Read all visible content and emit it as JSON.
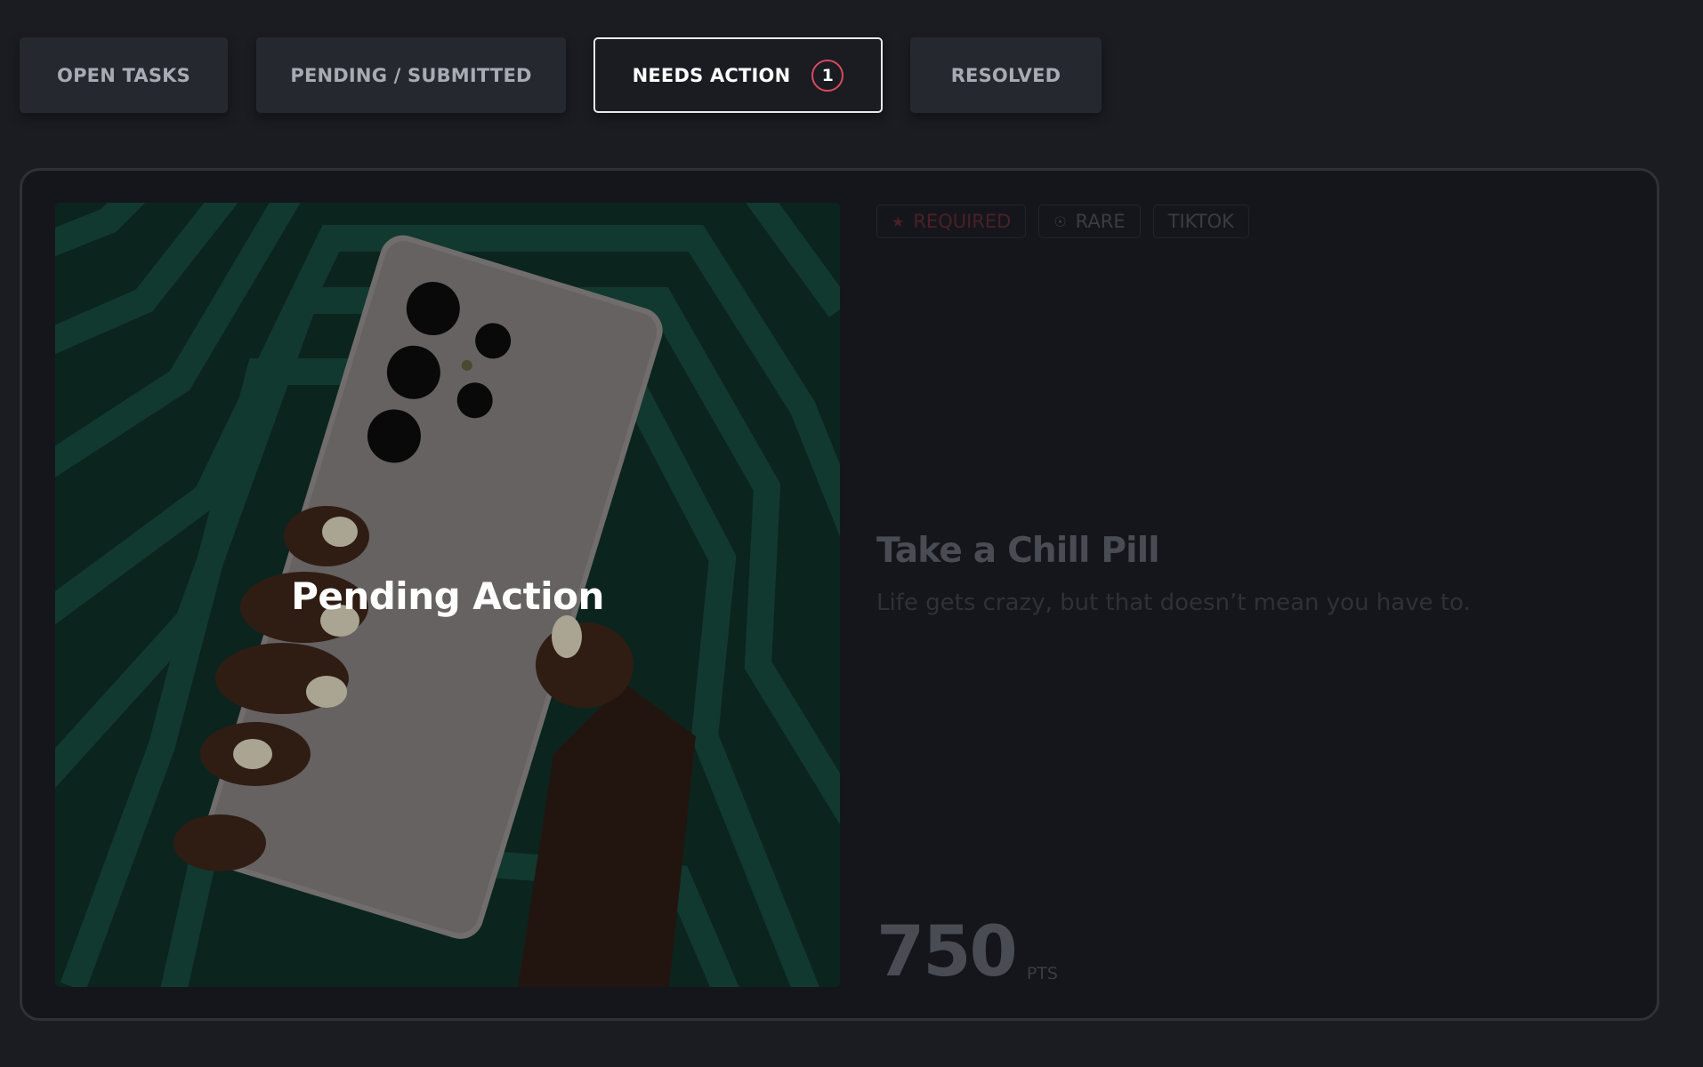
{
  "tabs": [
    {
      "label": "OPEN TASKS"
    },
    {
      "label": "PENDING / SUBMITTED"
    },
    {
      "label": "NEEDS ACTION",
      "badge": "1",
      "active": true
    },
    {
      "label": "RESOLVED"
    }
  ],
  "task": {
    "overlay_label": "Pending Action",
    "tags": [
      {
        "label": "REQUIRED",
        "icon": "star-icon"
      },
      {
        "label": "RARE",
        "icon": "medal-icon"
      },
      {
        "label": "TIKTOK"
      }
    ],
    "title": "Take a Chill Pill",
    "subtitle": "Life gets crazy, but that doesn’t mean you have to.",
    "points": "750",
    "points_unit": "PTS"
  },
  "colors": {
    "page_bg": "#1b1c21",
    "tab_bg": "#262830",
    "badge_border": "#d94a5c",
    "media_green": "#17463a"
  }
}
